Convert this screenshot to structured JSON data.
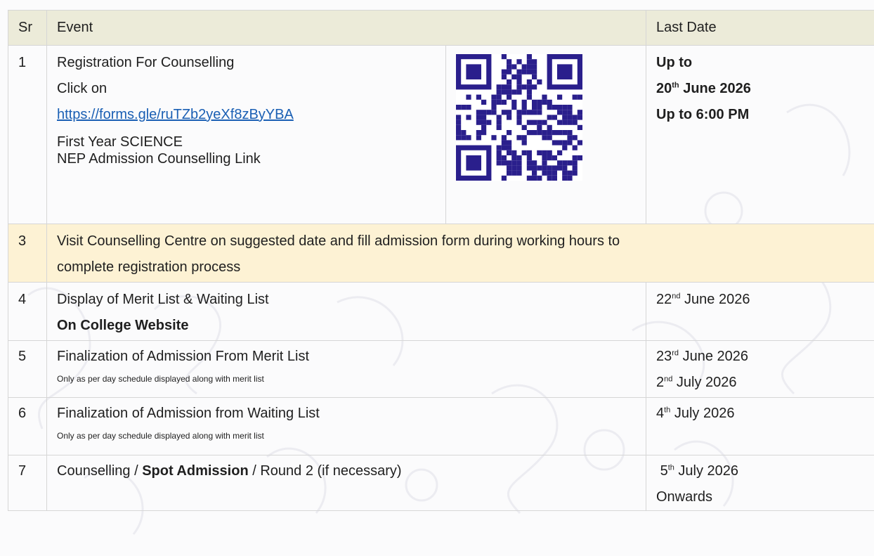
{
  "header": {
    "sr": "Sr",
    "event": "Event",
    "last_date": "Last Date"
  },
  "row1": {
    "sr": "1",
    "title": "Registration For Counselling",
    "click_on": "Click on",
    "link": "https://forms.gle/ruTZb2yeXf8zByYBA",
    "line1": "First Year  SCIENCE",
    "line2": "NEP Admission Counselling Link",
    "date_line1": "Up to",
    "date_day": "20",
    "date_sup": "th",
    "date_rest": " June 2026",
    "date_line3": "Up to 6:00 PM",
    "qr_icon": "qr-code"
  },
  "row3": {
    "sr": "3",
    "line1": "Visit Counselling Centre  on suggested date and fill admission form during working hours to",
    "line2": "complete registration process"
  },
  "row4": {
    "sr": "4",
    "title": "Display of Merit List & Waiting List",
    "subtitle": "On College Website",
    "date_day": "22",
    "date_sup": "nd",
    "date_rest": "  June  2026"
  },
  "row5": {
    "sr": "5",
    "title": "Finalization of Admission From Merit List",
    "note": "Only as per day schedule displayed along with merit list",
    "date1_day": "23",
    "date1_sup": "rd",
    "date1_rest": " June 2026",
    "date2_day": "2",
    "date2_sup": "nd",
    "date2_rest": " July 2026"
  },
  "row6": {
    "sr": "6",
    "title": "Finalization of Admission from Waiting List",
    "note": "Only as per day schedule displayed along with merit list",
    "date_day": "4",
    "date_sup": "th",
    "date_rest": " July 2026"
  },
  "row7": {
    "sr": "7",
    "part1": "Counselling / ",
    "part2": "Spot Admission",
    "part3": " / Round 2 (if necessary)",
    "date_day": "5",
    "date_sup": "th",
    "date_rest": " July 2026",
    "date_line2": "Onwards"
  },
  "colors": {
    "header_bg": "#ecebd9",
    "highlight_bg": "#fdf2d4",
    "link": "#1a5fb4",
    "qr": "#2a1f8c"
  }
}
